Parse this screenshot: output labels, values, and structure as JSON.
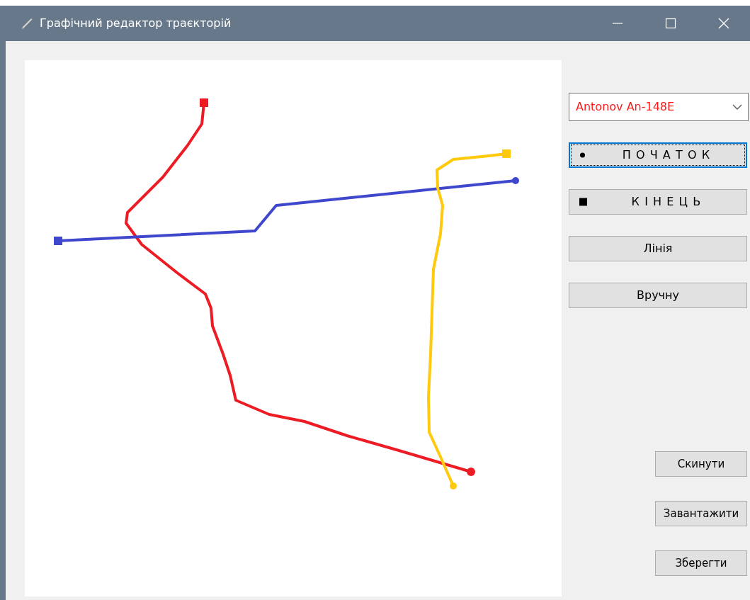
{
  "window": {
    "title": "Графічний редактор траєкторій"
  },
  "trajectories": [
    {
      "color": "#ed1c24"
    },
    {
      "color": "#3f48cc"
    },
    {
      "color": "#ffc90e"
    }
  ],
  "aircraft_select": {
    "value": "Antonov An-148E"
  },
  "tool_buttons": [
    {
      "kind": "start",
      "label": "ПОЧАТОК",
      "focused": true
    },
    {
      "kind": "end",
      "label": "КІНЕЦЬ",
      "focused": false
    },
    {
      "kind": "plain",
      "label": "Лінія",
      "focused": false
    },
    {
      "kind": "plain",
      "label": "Вручну",
      "focused": false
    }
  ],
  "action_buttons": [
    "Скинути",
    "Завантажити",
    "Зберегти"
  ]
}
